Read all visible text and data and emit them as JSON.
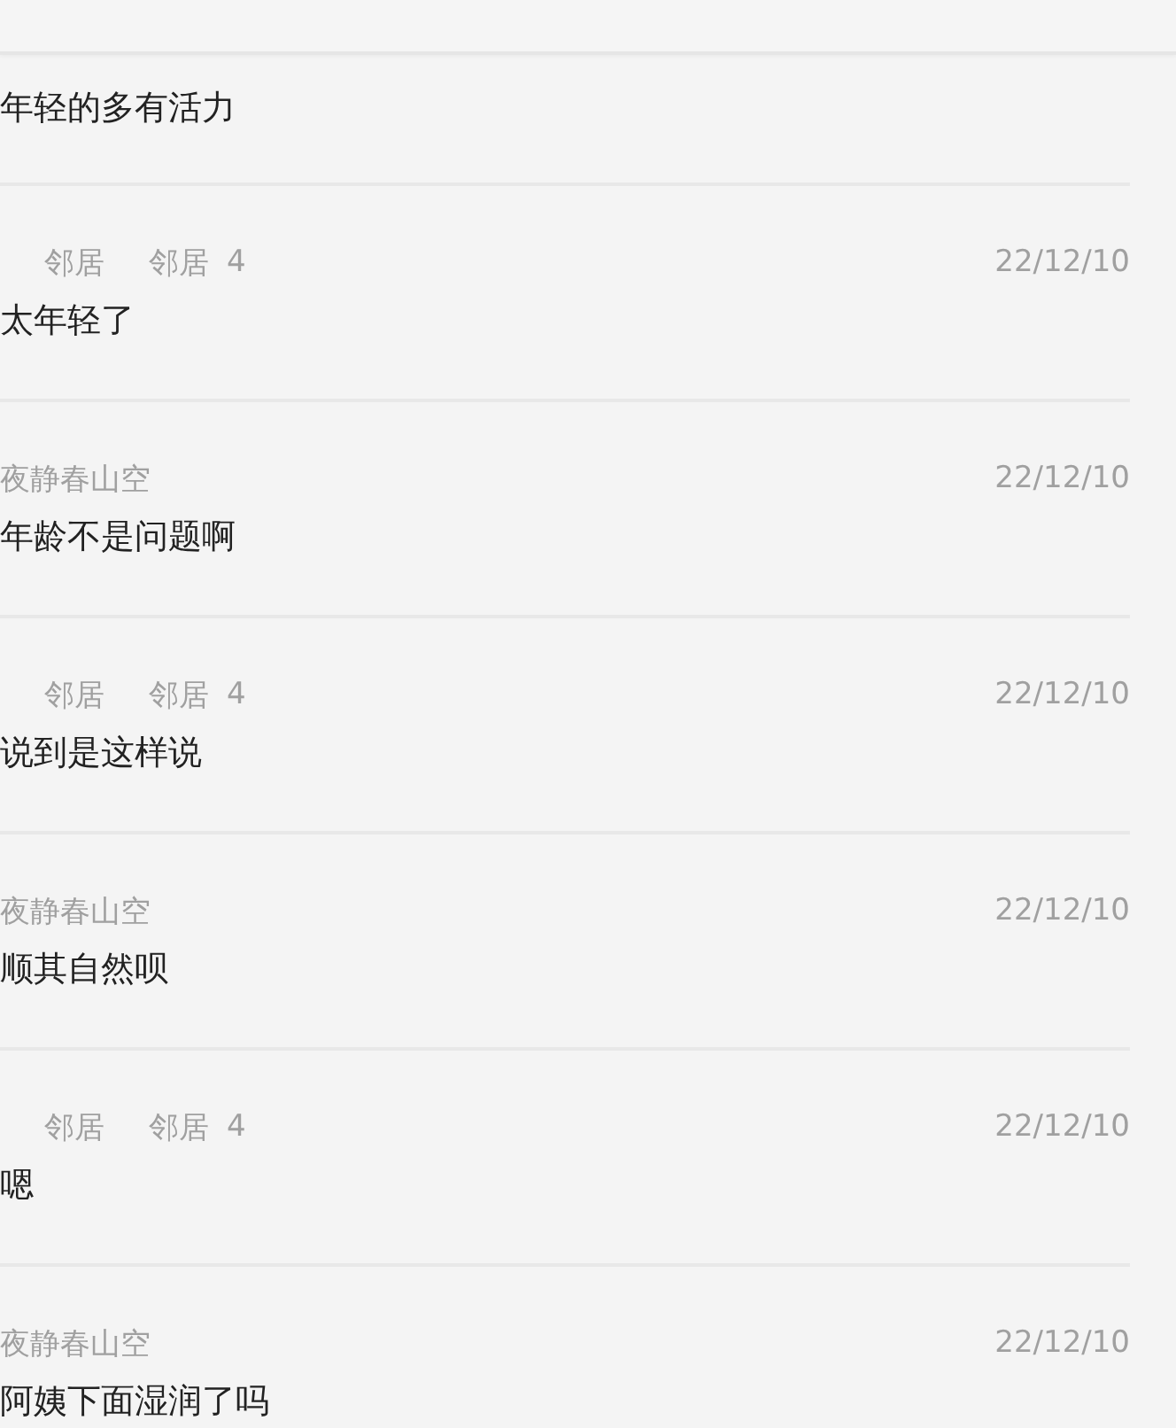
{
  "comments": [
    {
      "kind": "comment",
      "text": "年轻的多有活力"
    },
    {
      "kind": "reply",
      "author": "邻居",
      "target": "邻居",
      "badge": "4",
      "date": "22/12/10",
      "text": "太年轻了"
    },
    {
      "kind": "comment",
      "author": "夜静春山空",
      "date": "22/12/10",
      "text": "年龄不是问题啊"
    },
    {
      "kind": "reply",
      "author": "邻居",
      "target": "邻居",
      "badge": "4",
      "date": "22/12/10",
      "text": "说到是这样说"
    },
    {
      "kind": "comment",
      "author": "夜静春山空",
      "date": "22/12/10",
      "text": "顺其自然呗"
    },
    {
      "kind": "reply",
      "author": "邻居",
      "target": "邻居",
      "badge": "4",
      "date": "22/12/10",
      "text": "嗯"
    },
    {
      "kind": "comment",
      "author": "夜静春山空",
      "date": "22/12/10",
      "text": "阿姨下面湿润了吗"
    }
  ]
}
